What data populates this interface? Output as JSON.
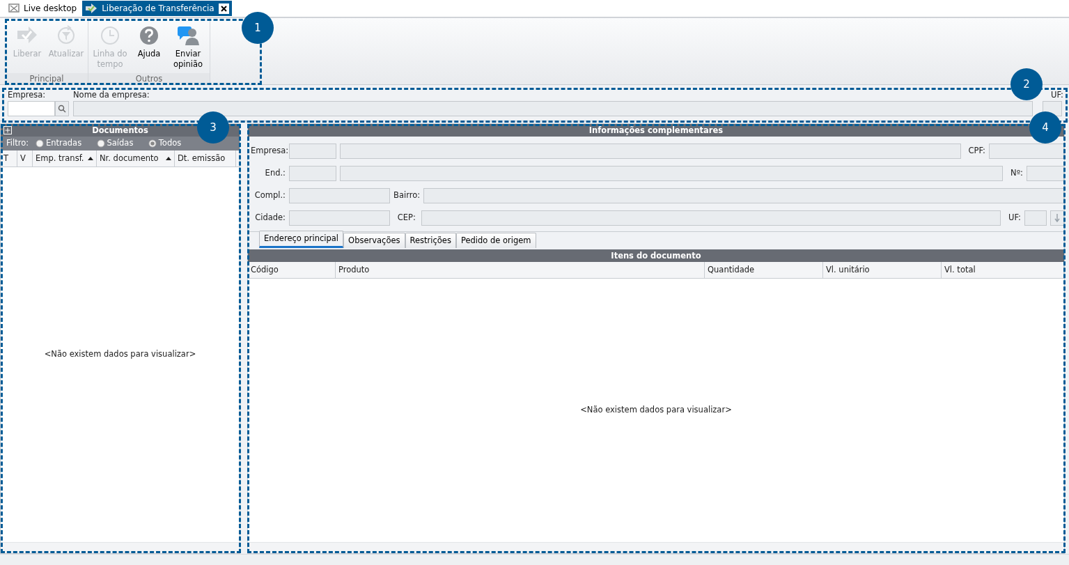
{
  "tabs": [
    {
      "label": "Live desktop",
      "selected": false
    },
    {
      "label": "Liberação de Transferência",
      "selected": true
    }
  ],
  "ribbon": {
    "groups": [
      {
        "label": "Principal",
        "buttons": [
          {
            "label": "Liberar",
            "kind": "release",
            "disabled": true
          },
          {
            "label": "Atualizar",
            "kind": "refresh",
            "disabled": true
          }
        ]
      },
      {
        "label": "Outros",
        "buttons": [
          {
            "label": "Linha do tempo",
            "kind": "clock",
            "disabled": true
          },
          {
            "label": "Ajuda",
            "kind": "help",
            "disabled": false
          },
          {
            "label": "Enviar opinião",
            "kind": "feedback",
            "disabled": false
          }
        ]
      }
    ]
  },
  "company_bar": {
    "code_label": "Empresa:",
    "name_label": "Nome da empresa:",
    "uf_label": "UF:"
  },
  "documents": {
    "title": "Documentos",
    "filter_label": "Filtro:",
    "filters": [
      {
        "label": "Entradas",
        "selected": false
      },
      {
        "label": "Saídas",
        "selected": false
      },
      {
        "label": "Todos",
        "selected": true
      }
    ],
    "columns": [
      {
        "label": "T",
        "sorted": false
      },
      {
        "label": "V",
        "sorted": false
      },
      {
        "label": "Emp. transf.",
        "sorted": true
      },
      {
        "label": "Nr. documento",
        "sorted": true
      },
      {
        "label": "Dt. emissão",
        "sorted": false
      }
    ],
    "empty_message": "<Não existem dados para visualizar>"
  },
  "details": {
    "title": "Informações complementares",
    "rows": [
      {
        "kind": "pair",
        "labels": [
          "Empresa:",
          "CPF:"
        ]
      },
      {
        "kind": "pair",
        "labels": [
          "End.:",
          "Nº:"
        ]
      },
      {
        "kind": "wide",
        "labels": [
          "Compl.:",
          "Bairro:"
        ]
      },
      {
        "kind": "state",
        "labels": [
          "Cidade:",
          "CEP:",
          "UF:"
        ]
      }
    ],
    "tabs": [
      {
        "label": "Endereço principal",
        "selected": true
      },
      {
        "label": "Observações",
        "selected": false
      },
      {
        "label": "Restrições",
        "selected": false
      },
      {
        "label": "Pedido de origem",
        "selected": false
      }
    ],
    "items": {
      "title": "Itens do documento",
      "columns": [
        "Código",
        "Produto",
        "Quantidade",
        "Vl. unitário",
        "Vl. total"
      ],
      "empty_message": "<Não existem dados para visualizar>"
    }
  },
  "callouts": [
    "1",
    "2",
    "3",
    "4"
  ]
}
